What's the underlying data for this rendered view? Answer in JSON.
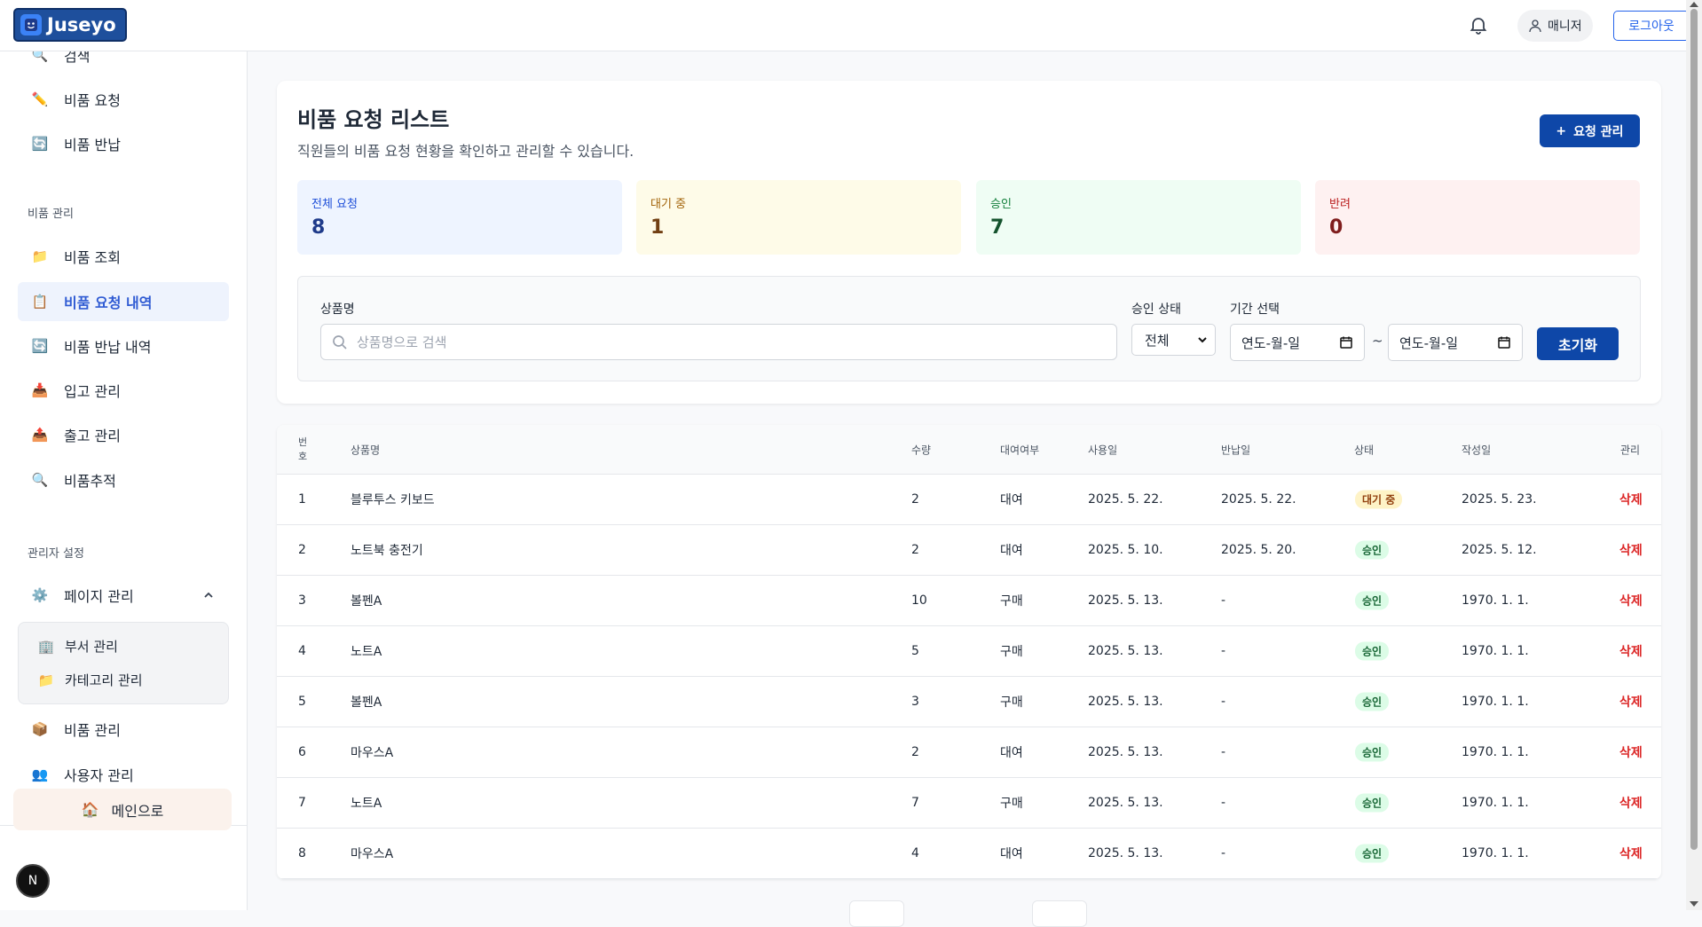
{
  "app": {
    "logo_text": "Juseyo"
  },
  "header": {
    "user_label": "매니저",
    "logout_label": "로그아웃"
  },
  "sidebar": {
    "top_items": [
      {
        "label": "검색",
        "icon": "magnifier-icon"
      },
      {
        "label": "비품 요청",
        "icon": "pencil-icon"
      },
      {
        "label": "비품 반납",
        "icon": "return-icon"
      }
    ],
    "section1": "비품 관리",
    "items": [
      {
        "label": "비품 조회",
        "icon": "folder-icon"
      },
      {
        "label": "비품 요청 내역",
        "icon": "clipboard-icon"
      },
      {
        "label": "비품 반납 내역",
        "icon": "return-icon"
      },
      {
        "label": "입고 관리",
        "icon": "inbox-icon"
      },
      {
        "label": "출고 관리",
        "icon": "outbox-icon"
      },
      {
        "label": "비품추적",
        "icon": "magnifier-icon"
      }
    ],
    "section2": "관리자 설정",
    "page_manage": "페이지 관리",
    "sub_items": [
      {
        "label": "부서 관리",
        "icon": "building-icon"
      },
      {
        "label": "카테고리 관리",
        "icon": "folder-icon"
      }
    ],
    "items2": [
      {
        "label": "비품 관리",
        "icon": "box-icon"
      },
      {
        "label": "사용자 관리",
        "icon": "users-icon"
      }
    ],
    "home_label": "메인으로",
    "n_badge": "N"
  },
  "page": {
    "title": "비품 요청 리스트",
    "subtitle": "직원들의 비품 요청 현황을 확인하고 관리할 수 있습니다.",
    "manage_button": "요청 관리",
    "manage_button_icon": "+"
  },
  "stats": [
    {
      "label": "전체 요청",
      "value": "8",
      "bg": "#eef4ff",
      "fg": "#1d4ed8",
      "val_fg": "#1e3a8a"
    },
    {
      "label": "대기 중",
      "value": "1",
      "bg": "#fefbe8",
      "fg": "#a16207",
      "val_fg": "#713f12"
    },
    {
      "label": "승인",
      "value": "7",
      "bg": "#effdf4",
      "fg": "#15803d",
      "val_fg": "#14532d"
    },
    {
      "label": "반려",
      "value": "0",
      "bg": "#fef1f1",
      "fg": "#b91c1c",
      "val_fg": "#7f1d1d"
    }
  ],
  "filter": {
    "product_label": "상품명",
    "search_placeholder": "상품명으로 검색",
    "status_label": "승인 상태",
    "status_value": "전체",
    "period_label": "기간 선택",
    "date_from": "연도-월-일",
    "date_to": "연도-월-일",
    "tilde": "~",
    "reset_button": "초기화"
  },
  "table": {
    "headers": {
      "no": "번\n호",
      "name": "상품명",
      "qty": "수량",
      "rent": "대여여부",
      "use_date": "사용일",
      "return_date": "반납일",
      "status": "상태",
      "created": "작성일",
      "manage": "관리"
    },
    "rows": [
      {
        "no": "1",
        "name": "블루투스 키보드",
        "qty": "2",
        "rent": "대여",
        "use_date": "2025. 5. 22.",
        "return_date": "2025. 5. 22.",
        "status": "대기 중",
        "created": "2025. 5. 23.",
        "action": "삭제"
      },
      {
        "no": "2",
        "name": "노트북 충전기",
        "qty": "2",
        "rent": "대여",
        "use_date": "2025. 5. 10.",
        "return_date": "2025. 5. 20.",
        "status": "승인",
        "created": "2025. 5. 12.",
        "action": "삭제"
      },
      {
        "no": "3",
        "name": "볼펜A",
        "qty": "10",
        "rent": "구매",
        "use_date": "2025. 5. 13.",
        "return_date": "-",
        "status": "승인",
        "created": "1970. 1. 1.",
        "action": "삭제"
      },
      {
        "no": "4",
        "name": "노트A",
        "qty": "5",
        "rent": "구매",
        "use_date": "2025. 5. 13.",
        "return_date": "-",
        "status": "승인",
        "created": "1970. 1. 1.",
        "action": "삭제"
      },
      {
        "no": "5",
        "name": "볼펜A",
        "qty": "3",
        "rent": "구매",
        "use_date": "2025. 5. 13.",
        "return_date": "-",
        "status": "승인",
        "created": "1970. 1. 1.",
        "action": "삭제"
      },
      {
        "no": "6",
        "name": "마우스A",
        "qty": "2",
        "rent": "대여",
        "use_date": "2025. 5. 13.",
        "return_date": "-",
        "status": "승인",
        "created": "1970. 1. 1.",
        "action": "삭제"
      },
      {
        "no": "7",
        "name": "노트A",
        "qty": "7",
        "rent": "구매",
        "use_date": "2025. 5. 13.",
        "return_date": "-",
        "status": "승인",
        "created": "1970. 1. 1.",
        "action": "삭제"
      },
      {
        "no": "8",
        "name": "마우스A",
        "qty": "4",
        "rent": "대여",
        "use_date": "2025. 5. 13.",
        "return_date": "-",
        "status": "승인",
        "created": "1970. 1. 1.",
        "action": "삭제"
      }
    ]
  },
  "status_colors": {
    "대기 중": {
      "bg": "#fef3c7",
      "fg": "#92400e"
    },
    "승인": {
      "bg": "#dcfce7",
      "fg": "#166534"
    }
  }
}
